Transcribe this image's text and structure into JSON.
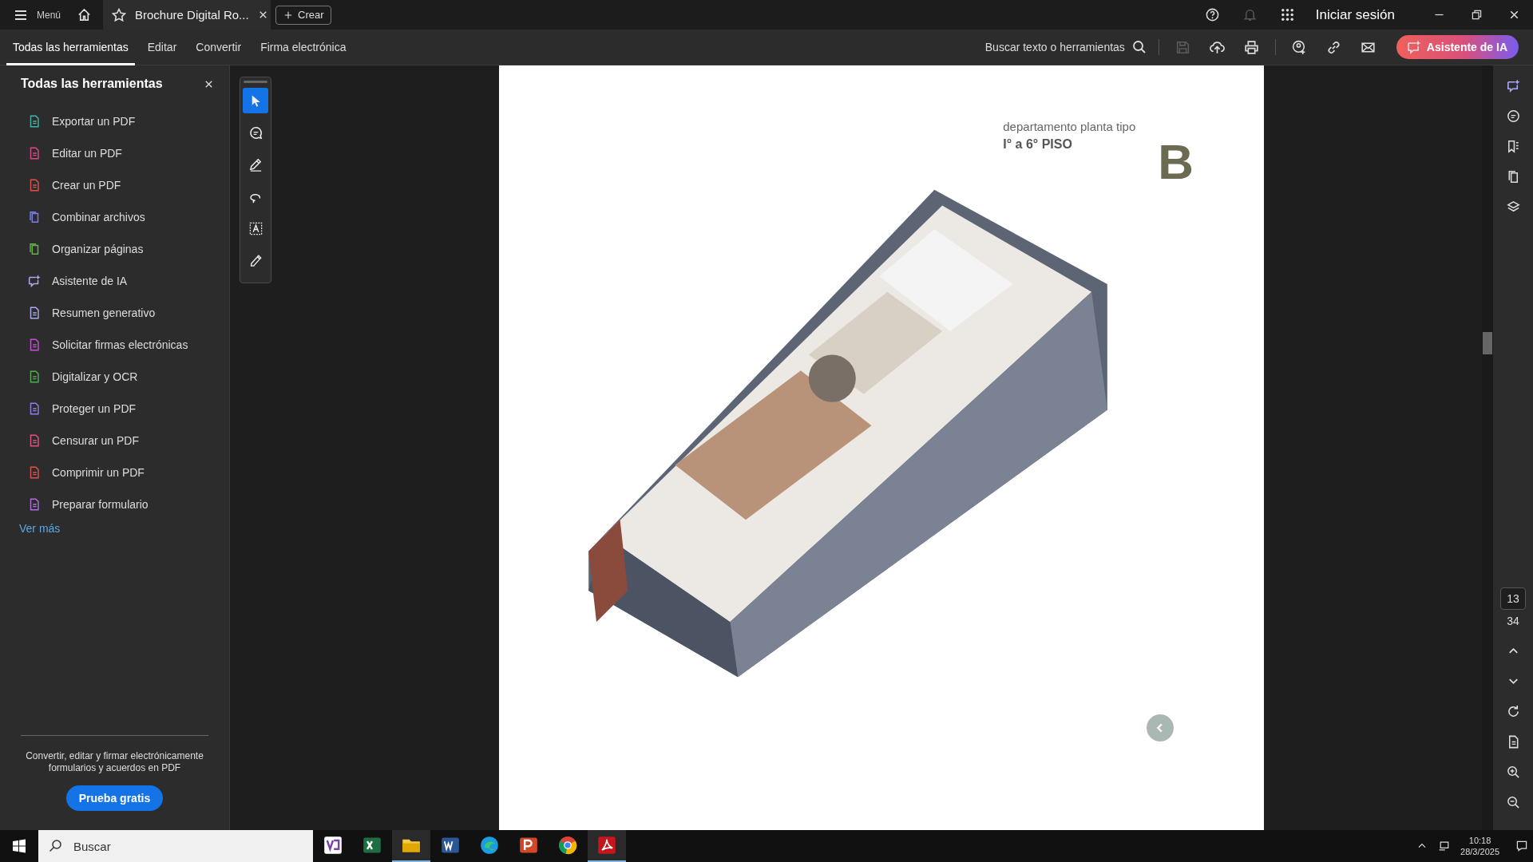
{
  "title_bar": {
    "menu_label": "Menú",
    "tab": {
      "title": "Brochure Digital Ro...",
      "selected": true
    },
    "create_button": "Crear",
    "sign_in": "Iniciar sesión"
  },
  "toolbar": {
    "tabs": [
      {
        "label": "Todas las herramientas",
        "selected": true
      },
      {
        "label": "Editar",
        "selected": false
      },
      {
        "label": "Convertir",
        "selected": false
      },
      {
        "label": "Firma electrónica",
        "selected": false
      }
    ],
    "search_label": "Buscar texto o herramientas",
    "save_disabled": true,
    "ai_button": "Asistente de IA"
  },
  "tools_panel": {
    "title": "Todas las herramientas",
    "items": [
      {
        "label": "Exportar un PDF",
        "color": "#3fb6a8"
      },
      {
        "label": "Editar un PDF",
        "color": "#d9468f"
      },
      {
        "label": "Crear un PDF",
        "color": "#e0504a"
      },
      {
        "label": "Combinar archivos",
        "color": "#7b7fe8"
      },
      {
        "label": "Organizar páginas",
        "color": "#6ab04c"
      },
      {
        "label": "Asistente de IA",
        "color": "#a9a9ee"
      },
      {
        "label": "Resumen generativo",
        "color": "#a9a9ee"
      },
      {
        "label": "Solicitar firmas electrónicas",
        "color": "#c54fd6"
      },
      {
        "label": "Digitalizar y OCR",
        "color": "#4caf50"
      },
      {
        "label": "Proteger un PDF",
        "color": "#8d7ff0"
      },
      {
        "label": "Censurar un PDF",
        "color": "#e05284"
      },
      {
        "label": "Comprimir un PDF",
        "color": "#e0504a"
      },
      {
        "label": "Preparar formulario",
        "color": "#b06ee0"
      }
    ],
    "more_link": "Ver más",
    "promo_text": "Convertir, editar y firmar electrónicamente formularios y acuerdos en PDF",
    "trial_button": "Prueba gratis"
  },
  "quick_tools": [
    {
      "kind": "select",
      "selected": true
    },
    {
      "kind": "comment",
      "selected": false
    },
    {
      "kind": "pen",
      "selected": false
    },
    {
      "kind": "lasso",
      "selected": false
    },
    {
      "kind": "text",
      "selected": false
    },
    {
      "kind": "sign",
      "selected": false
    }
  ],
  "page": {
    "subtitle": "departamento planta tipo",
    "floors": "I° a 6° PISO",
    "unit_letter": "B"
  },
  "page_nav": {
    "current": "13",
    "total": "34"
  },
  "taskbar": {
    "search_placeholder": "Buscar",
    "apps": [
      {
        "kind": "grid",
        "selected": false
      },
      {
        "kind": "sheet",
        "selected": false
      },
      {
        "kind": "folder",
        "selected": true
      },
      {
        "kind": "doc",
        "selected": false
      },
      {
        "kind": "wave",
        "selected": false
      },
      {
        "kind": "slides",
        "selected": false
      },
      {
        "kind": "globe",
        "selected": false
      },
      {
        "kind": "pdf",
        "selected": true
      }
    ],
    "time": "10:18",
    "date": "28/3/2025"
  }
}
